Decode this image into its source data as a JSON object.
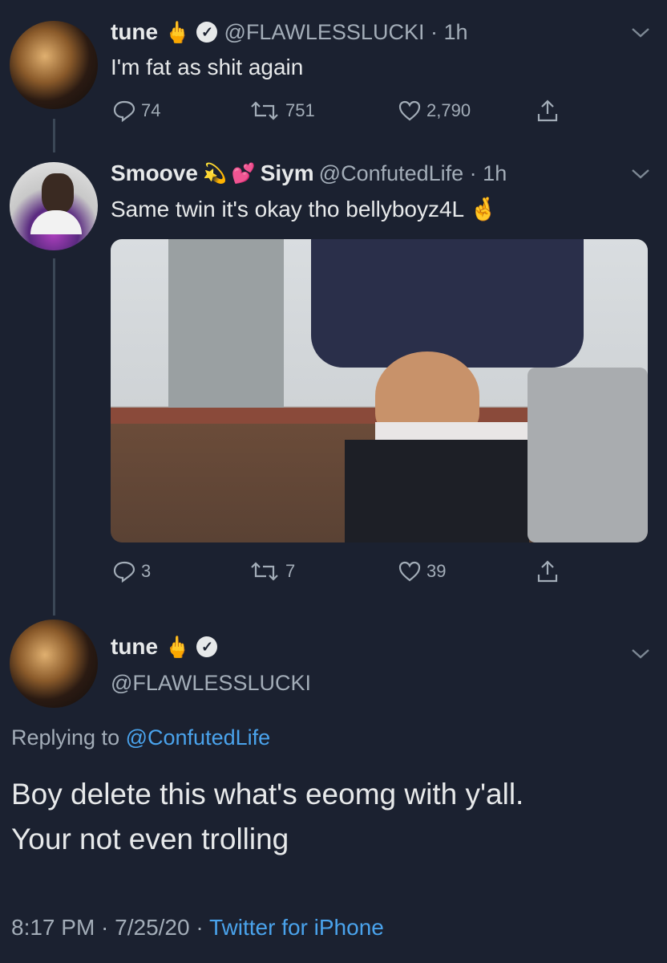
{
  "tweet1": {
    "display_name": "tune",
    "emoji": "🖕",
    "handle_time": "@FLAWLESSLUCKI · 1h",
    "text": "I'm fat as shit again",
    "replies": "74",
    "retweets": "751",
    "likes": "2,790"
  },
  "tweet2": {
    "display_name_a": "Smoove",
    "emoji_a": "💫",
    "emoji_b": "💕",
    "display_name_b": "Siym",
    "handle_time": "@ConfutedLife · 1h",
    "text": "Same twin it's okay tho bellyboyz4L",
    "text_emoji": "🤞",
    "replies": "3",
    "retweets": "7",
    "likes": "39"
  },
  "tweet3": {
    "display_name": "tune",
    "emoji": "🖕",
    "handle": "@FLAWLESSLUCKI",
    "replying_prefix": "Replying to",
    "replying_handle": "@ConfutedLife",
    "text_line1": "Boy delete this what's eeomg with y'all.",
    "text_line2": "Your not even trolling",
    "timestamp": "8:17 PM · 7/25/20 ·",
    "source": "Twitter for iPhone"
  },
  "icons": {
    "reply": "reply-icon",
    "retweet": "retweet-icon",
    "like": "heart-icon",
    "share": "share-icon",
    "more": "chevron-down-icon",
    "verified": "verified-icon"
  },
  "colors": {
    "background": "#1b2130",
    "link": "#4aa3ec",
    "secondary_text": "#a3adb8"
  }
}
